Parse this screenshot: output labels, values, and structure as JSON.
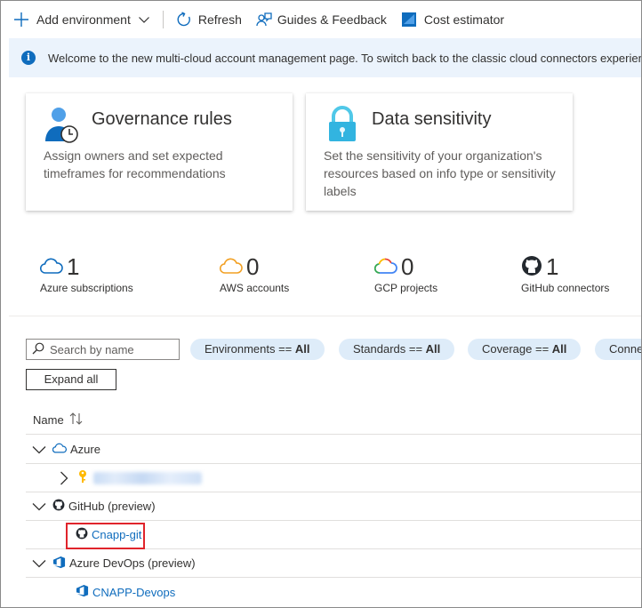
{
  "toolbar": {
    "add_environment": "Add environment",
    "refresh": "Refresh",
    "guides_feedback": "Guides & Feedback",
    "cost_estimator": "Cost estimator",
    "icons": [
      "plus-icon",
      "chevron-down-icon",
      "refresh-icon",
      "feedback-icon",
      "cost-estimator-icon"
    ]
  },
  "info_banner": {
    "text": "Welcome to the new multi-cloud account management page. To switch back to the classic cloud connectors experience"
  },
  "cards": [
    {
      "title": "Governance rules",
      "description": "Assign owners and set expected timeframes for recommendations",
      "icon": "governance-user-clock-icon"
    },
    {
      "title": "Data sensitivity",
      "description": "Set the sensitivity of your organization's resources based on info type or sensitivity labels",
      "icon": "lock-icon"
    }
  ],
  "stats": [
    {
      "value": "1",
      "label": "Azure subscriptions",
      "icon": "azure-cloud-icon"
    },
    {
      "value": "0",
      "label": "AWS accounts",
      "icon": "aws-cloud-icon"
    },
    {
      "value": "0",
      "label": "GCP projects",
      "icon": "gcp-cloud-icon"
    },
    {
      "value": "1",
      "label": "GitHub connectors",
      "icon": "github-icon"
    }
  ],
  "filters": {
    "search_placeholder": "Search by name",
    "pills": [
      {
        "label": "Environments == ",
        "value": "All"
      },
      {
        "label": "Standards == ",
        "value": "All"
      },
      {
        "label": "Coverage == ",
        "value": "All"
      },
      {
        "label": "Conne",
        "value": ""
      }
    ],
    "expand_all": "Expand all"
  },
  "tree": {
    "column_name": "Name",
    "rows": [
      {
        "label": "Azure",
        "expanded": true,
        "icon": "azure-cloud-icon"
      },
      {
        "label": "",
        "expanded": false,
        "icon": "key-icon",
        "redacted": true
      },
      {
        "label": "GitHub (preview)",
        "expanded": true,
        "icon": "github-icon"
      },
      {
        "label": "Cnapp-git",
        "icon": "github-icon",
        "highlighted": true
      },
      {
        "label": "Azure DevOps (preview)",
        "expanded": true,
        "icon": "azure-devops-icon"
      },
      {
        "label": "CNAPP-Devops",
        "icon": "azure-devops-icon"
      }
    ]
  },
  "colors": {
    "accent": "#0f6cbd",
    "pill_bg": "#deecf9",
    "info_bg": "#ebf3fc",
    "highlight_border": "#e0242b"
  }
}
